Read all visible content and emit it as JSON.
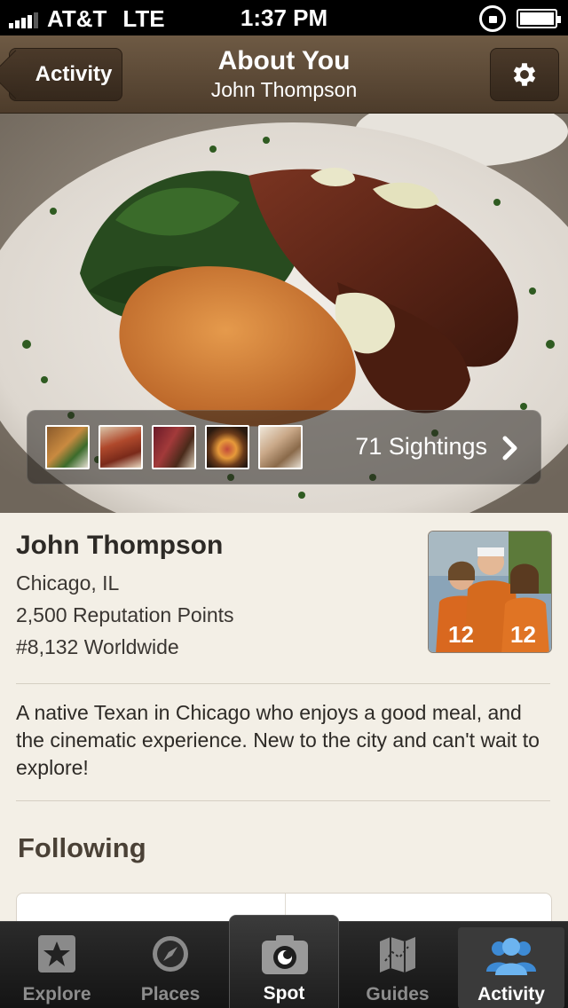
{
  "status_bar": {
    "carrier": "AT&T",
    "network": "LTE",
    "time": "1:37 PM"
  },
  "nav": {
    "back_label": "Activity",
    "title": "About You",
    "subtitle": "John Thompson"
  },
  "hero": {
    "sightings_label": "71 Sightings"
  },
  "profile": {
    "name": "John Thompson",
    "location": "Chicago, IL",
    "reputation": "2,500 Reputation Points",
    "rank": "#8,132 Worldwide",
    "bio": "A native Texan in Chicago who enjoys a good meal, and the cinematic experience. New to the city and can't wait to explore!",
    "following_title": "Following"
  },
  "tab_bar": {
    "tabs": [
      {
        "label": "Explore",
        "icon": "star-icon"
      },
      {
        "label": "Places",
        "icon": "compass-icon"
      },
      {
        "label": "Spot",
        "icon": "camera-icon"
      },
      {
        "label": "Guides",
        "icon": "map-icon"
      },
      {
        "label": "Activity",
        "icon": "people-icon"
      }
    ],
    "active": "Activity"
  },
  "colors": {
    "nav_brown": "#5e4b37",
    "background": "#f3efe6",
    "active_blue": "#4a9be0"
  }
}
